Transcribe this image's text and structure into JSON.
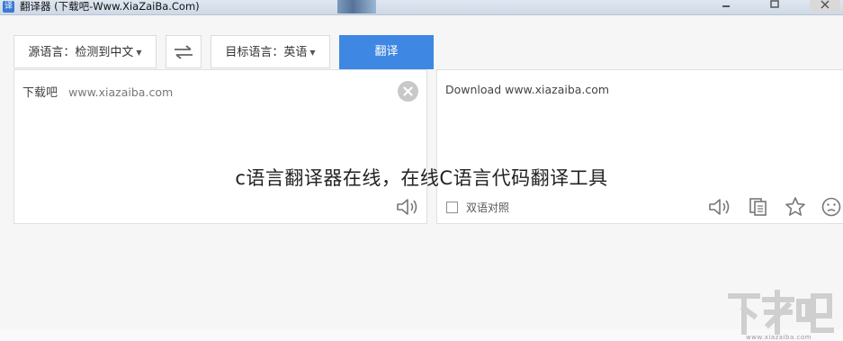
{
  "window": {
    "title": "翻译器 (下载吧-Www.XiaZaiBa.Com)",
    "icon": "app-translate-icon",
    "controls": [
      "minimize-icon",
      "maximize-icon",
      "close-icon"
    ]
  },
  "toolbar": {
    "source_language": "源语言：检测到中文",
    "target_language": "目标语言：英语",
    "translate_label": "翻译",
    "swap_icon": "swap-arrows-icon",
    "accent": "#3e87e2"
  },
  "input": {
    "text_cn": "下载吧",
    "text_url": "www.xiazaiba.com",
    "clear_icon": "clear-x-icon",
    "speaker_icon": "speaker-icon"
  },
  "output": {
    "text": "Download www.xiazaiba.com",
    "bilingual_label": "双语对照",
    "icons": [
      "speaker-icon",
      "copy-icon",
      "star-icon",
      "smile-icon"
    ]
  },
  "overlay": {
    "caption": "c语言翻译器在线，在线C语言代码翻译工具"
  },
  "watermark": {
    "logo_text": "下载吧",
    "site": "www.xiazaiba.com"
  }
}
